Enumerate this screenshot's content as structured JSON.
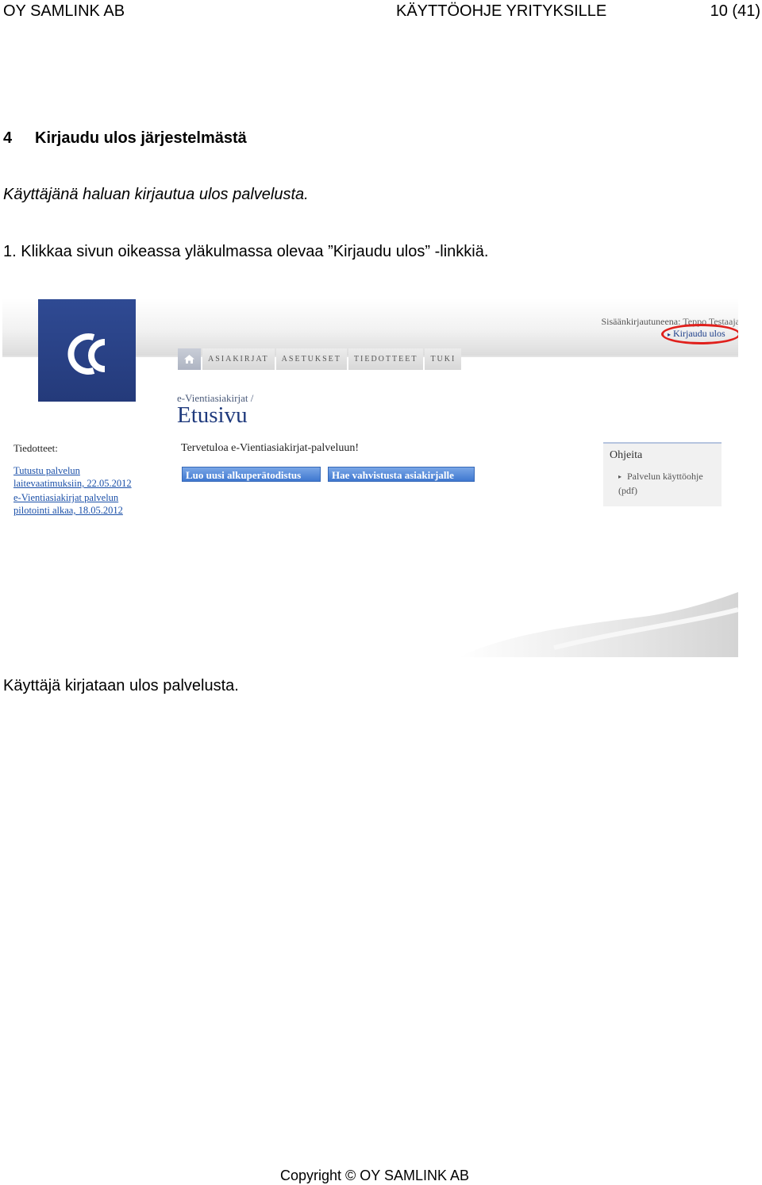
{
  "header": {
    "company": "OY SAMLINK AB",
    "doc_title": "KÄYTTÖOHJE YRITYKSILLE",
    "page": "10 (41)"
  },
  "section": {
    "number": "4",
    "title": "Kirjaudu ulos järjestelmästä",
    "intro": "Käyttäjänä haluan kirjautua ulos palvelusta.",
    "step1": "1. Klikkaa sivun oikeassa yläkulmassa olevaa ”Kirjaudu ulos” -linkkiä.",
    "result": "Käyttäjä kirjataan ulos palvelusta."
  },
  "screenshot": {
    "login_label": "Sisäänkirjautuneena:",
    "login_user": "Teppo Testaaja",
    "logout_link": "Kirjaudu ulos",
    "nav": [
      "ASIAKIRJAT",
      "ASETUKSET",
      "TIEDOTTEET",
      "TUKI"
    ],
    "breadcrumb": "e-Vientiasiakirjat /",
    "page_title": "Etusivu",
    "news_label": "Tiedotteet:",
    "news": [
      {
        "line1": "Tutustu palvelun",
        "line2": "laitevaatimuksiin, 22.05.2012"
      },
      {
        "line1": "e-Vientiasiakirjat palvelun",
        "line2": "pilotointi alkaa, 18.05.2012"
      }
    ],
    "welcome": "Tervetuloa e-Vientiasiakirjat-palveluun!",
    "buttons": [
      "Luo uusi alkuperätodistus",
      "Hae vahvistusta asiakirjalle"
    ],
    "help_title": "Ohjeita",
    "help_link_line1": "Palvelun käyttöohje",
    "help_link_line2": "(pdf)",
    "accent_color": "#1f3a7d",
    "highlight_color": "#e0201c"
  },
  "footer": {
    "copyright": "Copyright © OY SAMLINK AB"
  }
}
